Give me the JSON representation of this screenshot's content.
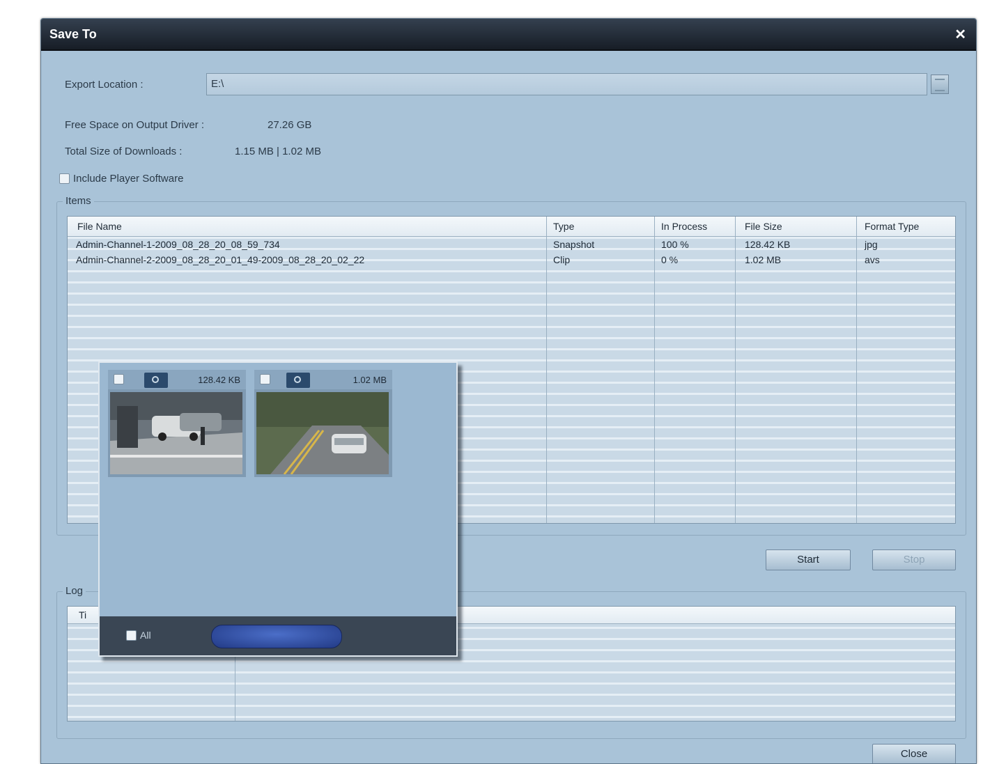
{
  "window": {
    "title": "Save To"
  },
  "export": {
    "label": "Export Location :",
    "value": "E:\\"
  },
  "free_space": {
    "label": "Free Space on Output Driver :",
    "value": "27.26 GB"
  },
  "total_size": {
    "label": "Total Size of Downloads :",
    "value": "1.15 MB | 1.02 MB"
  },
  "include_player": {
    "label": "Include Player Software",
    "checked": false
  },
  "items": {
    "title": "Items",
    "columns": [
      "File Name",
      "Type",
      "In Process",
      "File Size",
      "Format Type"
    ],
    "rows": [
      [
        "Admin-Channel-1-2009_08_28_20_08_59_734",
        "Snapshot",
        "100 %",
        "128.42 KB",
        "jpg"
      ],
      [
        "Admin-Channel-2-2009_08_28_20_01_49-2009_08_28_20_02_22",
        "Clip",
        "0 %",
        "1.02 MB",
        "avs"
      ]
    ]
  },
  "buttons": {
    "start": "Start",
    "stop": "Stop",
    "close": "Close"
  },
  "log": {
    "title": "Log",
    "col1": "Ti"
  },
  "popup": {
    "thumbs": [
      {
        "size": "128.42 KB",
        "icon": "camera-icon"
      },
      {
        "size": "1.02 MB",
        "icon": "video-icon"
      }
    ],
    "all_label": "All"
  }
}
